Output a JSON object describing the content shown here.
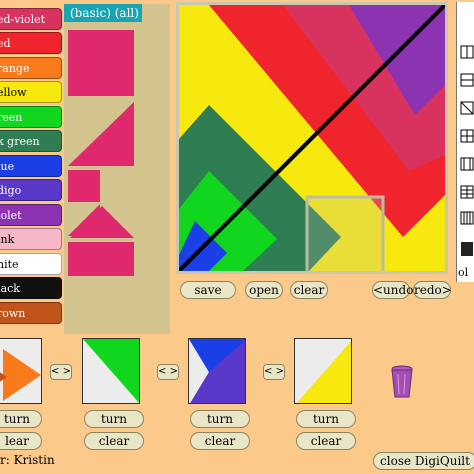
{
  "colors": [
    {
      "label": "red-violet",
      "hex": "#d8335f"
    },
    {
      "label": "red",
      "hex": "#f0242d"
    },
    {
      "label": "orange",
      "hex": "#f87a1a"
    },
    {
      "label": "yellow",
      "hex": "#f7e80e"
    },
    {
      "label": "green",
      "hex": "#10d61e"
    },
    {
      "label": "dark green",
      "hex": "#2e7d53"
    },
    {
      "label": "blue",
      "hex": "#1b3fe6"
    },
    {
      "label": "indigo",
      "hex": "#5a38c9"
    },
    {
      "label": "violet",
      "hex": "#8c33b1"
    },
    {
      "label": "pink",
      "hex": "#f6b7c8"
    },
    {
      "label": "white",
      "hex": "#ffffff"
    },
    {
      "label": "black",
      "hex": "#111111"
    },
    {
      "label": "brown",
      "hex": "#c0541a"
    }
  ],
  "color_labels_visible": [
    "ed-violet",
    "ed",
    "range",
    "ellow",
    "reen",
    "k green",
    "lue",
    "digo",
    "iolet",
    "ink",
    "hite",
    "lack",
    "rown"
  ],
  "palette": {
    "tabs_label": "(basic)  (all)",
    "shape_color": "#e0286e"
  },
  "canvas_controls": {
    "save": "save",
    "open": "open",
    "clear": "clear",
    "undo": "<undo",
    "redo": "redo>"
  },
  "tool_strip_partial_label": "ol",
  "slots": [
    {
      "turn": "turn",
      "clear": "lear"
    },
    {
      "turn": "turn",
      "clear": "clear"
    },
    {
      "turn": "turn",
      "clear": "clear"
    },
    {
      "turn": "turn",
      "clear": "clear"
    }
  ],
  "swap_label": "< >",
  "author_partial": "r: Kristin",
  "close_button": "close DigiQuilt"
}
